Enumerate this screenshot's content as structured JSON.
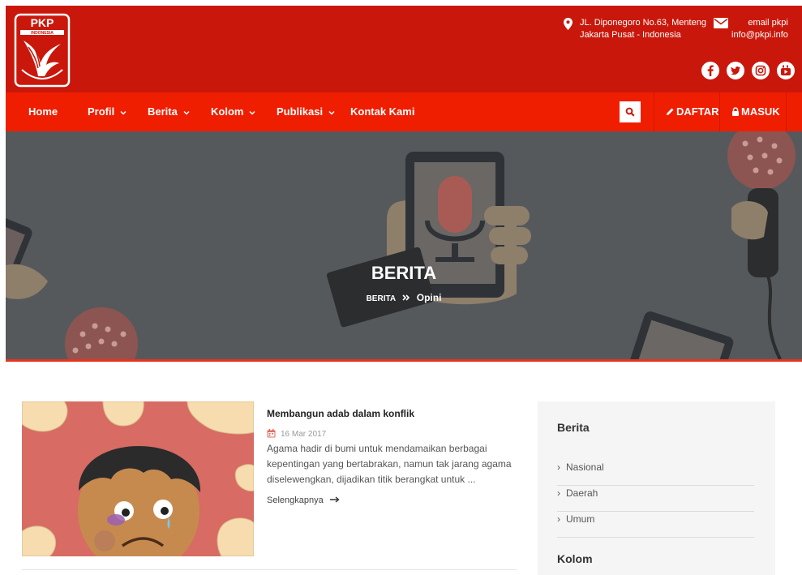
{
  "header": {
    "logo_text": "PKP INDONESIA",
    "address_line1": "JL. Diponegoro No.63, Menteng",
    "address_line2": "Jakarta Pusat - Indonesia",
    "email_label": "email pkpi",
    "email_value": "info@pkpi.info",
    "social_icons": [
      "facebook-icon",
      "twitter-icon",
      "instagram-icon",
      "youtube-icon"
    ]
  },
  "nav": {
    "items": [
      {
        "label": "Home"
      },
      {
        "label": "Profil",
        "dropdown": true
      },
      {
        "label": "Berita",
        "dropdown": true
      },
      {
        "label": "Kolom",
        "dropdown": true
      },
      {
        "label": "Publikasi",
        "dropdown": true
      },
      {
        "label": "Kontak Kami"
      }
    ],
    "daftar_label": "DAFTAR",
    "masuk_label": "MASUK"
  },
  "hero": {
    "title": "BERITA",
    "breadcrumb": [
      "BERITA",
      "Opini"
    ]
  },
  "article": {
    "title": "Membangun adab dalam konflik",
    "date": "16 Mar 2017",
    "excerpt": "Agama hadir di bumi untuk mendamaikan berbagai kepentingan yang bertabrakan, namun tak jarang agama diselewengkan, dijadikan titik berangkat untuk ...",
    "read_more": "Selengkapnya"
  },
  "sidebar": {
    "heading1": "Berita",
    "items": [
      {
        "label": "Nasional"
      },
      {
        "label": "Daerah"
      },
      {
        "label": "Umum"
      }
    ],
    "heading2": "Kolom"
  },
  "colors": {
    "header_red": "#c9180b",
    "nav_red": "#f01e00",
    "hero_overlay": "#56595c"
  }
}
